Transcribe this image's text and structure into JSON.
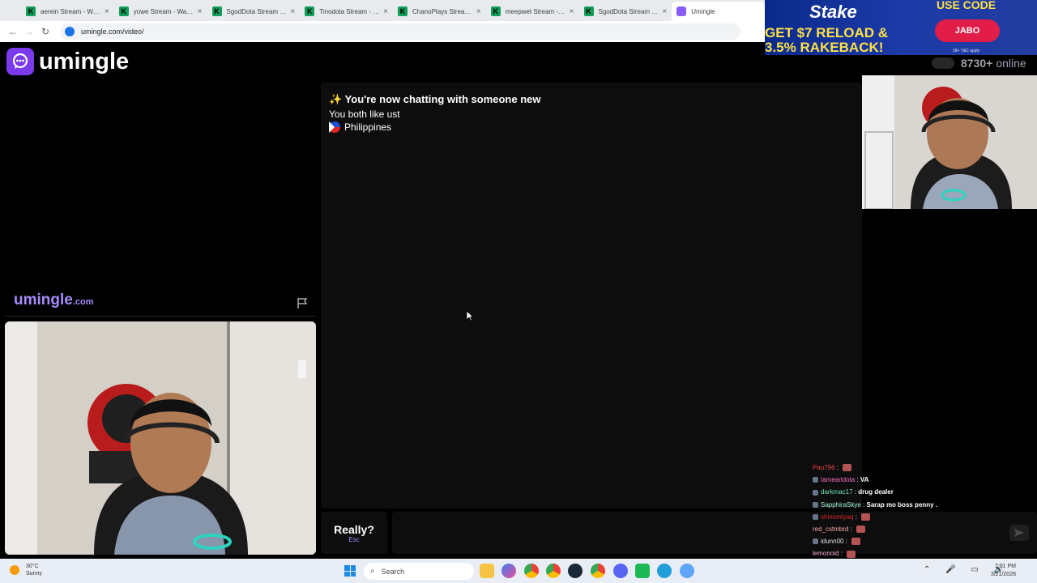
{
  "browser": {
    "tabs": [
      {
        "title": "aerein Stream - Watch L"
      },
      {
        "title": "yowe Stream - Watch Li"
      },
      {
        "title": "SgodDota Stream - Wat"
      },
      {
        "title": "Tinodota Stream - Watc"
      },
      {
        "title": "ChanoPlays Stream - W"
      },
      {
        "title": "meepwet Stream - Wat"
      },
      {
        "title": "SgodDota Stream - Wat"
      },
      {
        "title": "Umingle"
      }
    ],
    "url": "umingle.com/video/"
  },
  "ad": {
    "brand": "Stake",
    "promo": "GET $7 RELOAD & 3.5% RAKEBACK!",
    "use_code_label": "USE CODE",
    "code": "JABO",
    "terms": "18+ T&C apply"
  },
  "site": {
    "logo_text": "umingle",
    "online_count": "8730+",
    "online_label": "online",
    "watermark": "umingle",
    "watermark_suffix": ".com"
  },
  "chat": {
    "system_message": "✨ You're now chatting with someone new",
    "common_interest": "You both like ust",
    "country": "Philippines"
  },
  "controls": {
    "skip_label": "Really?",
    "skip_hint": "Esc"
  },
  "stream_chat": [
    {
      "user": "Pau796",
      "color": "#ef4444",
      "message": "",
      "emote": true,
      "badge": false
    },
    {
      "user": "Iamearldota",
      "color": "#f472b6",
      "message": "VA",
      "emote": false,
      "badge": true
    },
    {
      "user": "darkmac17",
      "color": "#6ee7b7",
      "message": "drug dealer",
      "emote": false,
      "badge": true
    },
    {
      "user": "SapphiraSkye",
      "color": "#a7f3d0",
      "message": "Sarap mo boss penny .",
      "emote": false,
      "badge": true
    },
    {
      "user": "shinomiyaq",
      "color": "#dc2626",
      "message": "",
      "emote": true,
      "badge": true
    },
    {
      "user": "red_cstmbrd",
      "color": "#fca5a5",
      "message": "",
      "emote": true,
      "badge": false
    },
    {
      "user": "idunn00",
      "color": "#e5e7eb",
      "message": "",
      "emote": true,
      "badge": true
    },
    {
      "user": "lemonoid",
      "color": "#f9a8d4",
      "message": "",
      "emote": true,
      "badge": false
    }
  ],
  "taskbar": {
    "temperature": "30°C",
    "weather": "Sunny",
    "search_placeholder": "Search",
    "time": "7:01 PM",
    "date": "3/21/2026"
  }
}
